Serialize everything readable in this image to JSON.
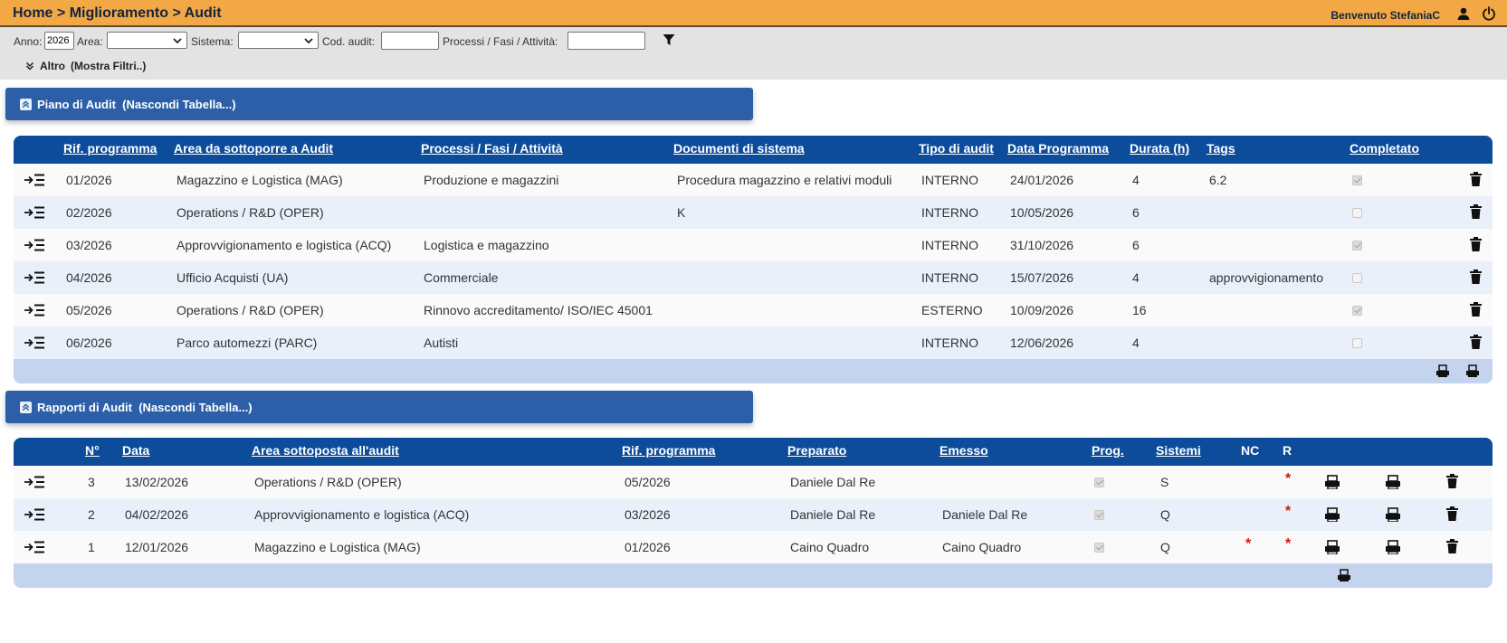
{
  "header": {
    "breadcrumb": "Home > Miglioramento > Audit",
    "welcome": "Benvenuto StefaniaC",
    "icons": [
      "user-icon",
      "power-icon"
    ]
  },
  "filters": {
    "anno_label": "Anno:",
    "anno_value": "2026",
    "area_label": "Area:",
    "area_value": "",
    "sistema_label": "Sistema:",
    "sistema_value": "",
    "cod_label": "Cod. audit:",
    "cod_value": "",
    "processi_label": "Processi / Fasi / Attività:",
    "processi_value": "",
    "altro_label": "Altro",
    "mostra_label": "(Mostra Filtri..)",
    "filter_icon": "funnel-icon"
  },
  "piano": {
    "title": "Piano di Audit",
    "toggle": "(Nascondi Tabella...)",
    "columns": [
      "Rif. programma",
      "Area da sottoporre a Audit",
      "Processi / Fasi / Attività",
      "Documenti di sistema",
      "Tipo di audit",
      "Data Programma",
      "Durata (h)",
      "Tags",
      "Completato"
    ],
    "rows": [
      {
        "rif": "01/2026",
        "area": "Magazzino e Logistica (MAG)",
        "processi": "Produzione e magazzini",
        "documenti": "Procedura magazzino e relativi moduli",
        "tipo": "INTERNO",
        "data": "24/01/2026",
        "durata": "4",
        "tags": "6.2",
        "completato": true
      },
      {
        "rif": "02/2026",
        "area": "Operations / R&D (OPER)",
        "processi": "",
        "documenti": "K",
        "tipo": "INTERNO",
        "data": "10/05/2026",
        "durata": "6",
        "tags": "",
        "completato": false
      },
      {
        "rif": "03/2026",
        "area": "Approvvigionamento e logistica (ACQ)",
        "processi": "Logistica e magazzino",
        "documenti": "",
        "tipo": "INTERNO",
        "data": "31/10/2026",
        "durata": "6",
        "tags": "",
        "completato": true
      },
      {
        "rif": "04/2026",
        "area": "Ufficio Acquisti (UA)",
        "processi": "Commerciale",
        "documenti": "",
        "tipo": "INTERNO",
        "data": "15/07/2026",
        "durata": "4",
        "tags": "approvvigionamento",
        "completato": false
      },
      {
        "rif": "05/2026",
        "area": "Operations / R&D (OPER)",
        "processi": "Rinnovo accreditamento/ ISO/IEC 45001",
        "documenti": "",
        "tipo": "ESTERNO",
        "data": "10/09/2026",
        "durata": "16",
        "tags": "",
        "completato": true
      },
      {
        "rif": "06/2026",
        "area": "Parco automezzi (PARC)",
        "processi": "Autisti",
        "documenti": "",
        "tipo": "INTERNO",
        "data": "12/06/2026",
        "durata": "4",
        "tags": "",
        "completato": false
      }
    ]
  },
  "rapporti": {
    "title": "Rapporti di Audit",
    "toggle": "(Nascondi Tabella...)",
    "columns": [
      "N°",
      "Data",
      "Area sottoposta all'audit",
      "Rif. programma",
      "Preparato",
      "Emesso",
      "Prog.",
      "Sistemi",
      "NC",
      "R"
    ],
    "rows": [
      {
        "n": "3",
        "data": "13/02/2026",
        "area": "Operations / R&D (OPER)",
        "rif": "05/2026",
        "preparato": "Daniele Dal Re",
        "emesso": "",
        "prog": true,
        "sistemi": "S",
        "nc": "",
        "r": "*"
      },
      {
        "n": "2",
        "data": "04/02/2026",
        "area": "Approvvigionamento e logistica (ACQ)",
        "rif": "03/2026",
        "preparato": "Daniele Dal Re",
        "emesso": "Daniele Dal Re",
        "prog": true,
        "sistemi": "Q",
        "nc": "",
        "r": "*"
      },
      {
        "n": "1",
        "data": "12/01/2026",
        "area": "Magazzino e Logistica (MAG)",
        "rif": "01/2026",
        "preparato": "Caino Quadro",
        "emesso": "Caino Quadro",
        "prog": true,
        "sistemi": "Q",
        "nc": "*",
        "r": "*"
      }
    ]
  },
  "colors": {
    "topbar": "#f2a845",
    "section": "#2c5fa8",
    "table_header": "#0d4c9a",
    "row_alt": "#e9f0fa",
    "footer": "#c4d3ee",
    "star": "#e01010"
  }
}
